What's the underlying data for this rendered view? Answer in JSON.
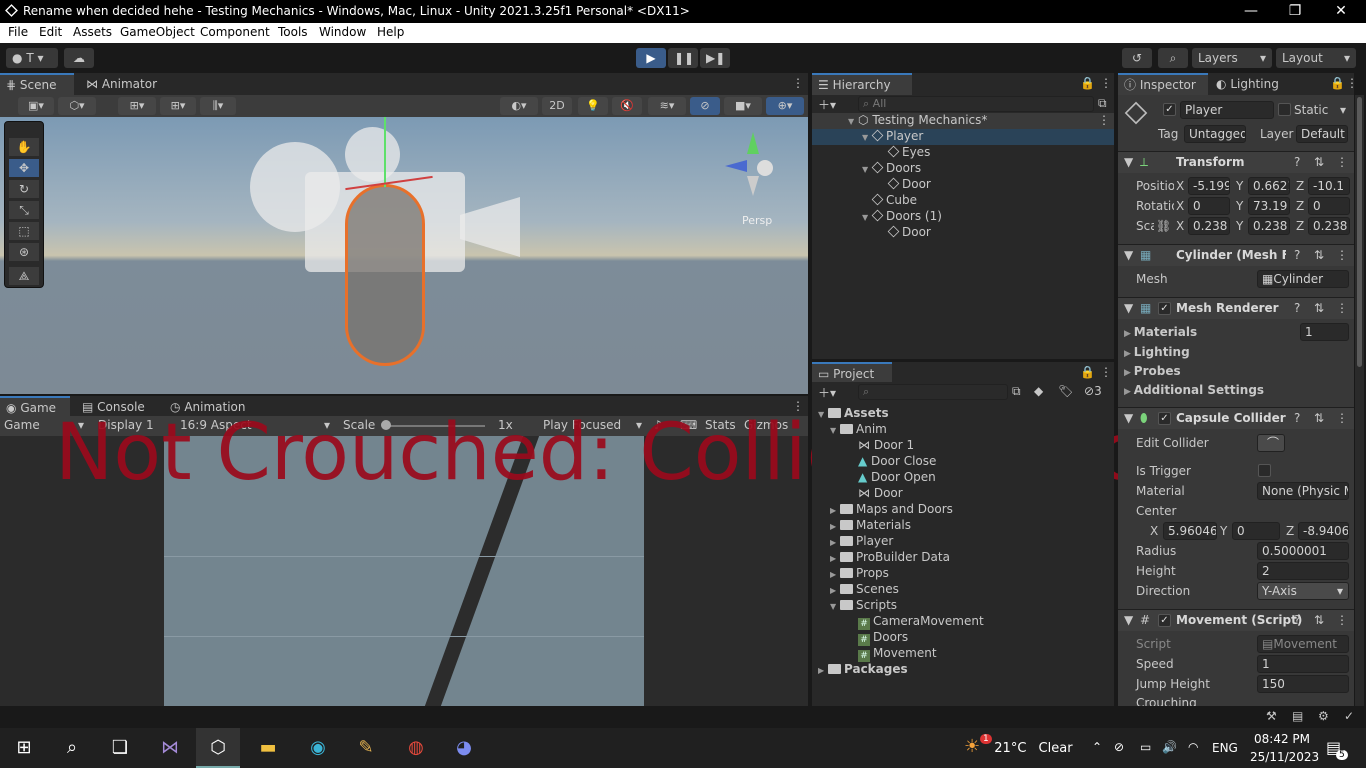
{
  "window": {
    "title": "Rename when decided hehe - Testing Mechanics - Windows, Mac, Linux - Unity 2021.3.25f1 Personal* <DX11>",
    "min": "—",
    "max": "❐",
    "close": "✕"
  },
  "menu": [
    "File",
    "Edit",
    "Assets",
    "GameObject",
    "Component",
    "Tools",
    "Window",
    "Help"
  ],
  "toolbar": {
    "account": "T",
    "layers": "Layers",
    "layout": "Layout"
  },
  "scene": {
    "tabs": [
      "Scene",
      "Animator"
    ],
    "btn2d": "2D",
    "persp": "Persp"
  },
  "game": {
    "tabs": [
      "Game",
      "Console",
      "Animation"
    ],
    "view": "Game",
    "display": "Display 1",
    "aspect": "16:9 Aspect",
    "scale_label": "Scale",
    "scale_value": "1x",
    "play_mode": "Play Focused",
    "stats": "Stats",
    "gizmos": "Gizmos",
    "overlay": "Not Crouched: Collider is normal"
  },
  "hierarchy": {
    "title": "Hierarchy",
    "search": "All",
    "root": "Testing Mechanics*",
    "items": [
      "Player",
      "Eyes",
      "Doors",
      "Door",
      "Cube",
      "Doors (1)",
      "Door"
    ]
  },
  "project": {
    "title": "Project",
    "hidden_count": "3",
    "root": "Assets",
    "anim": "Anim",
    "anim_items": [
      "Door 1",
      "Door Close",
      "Door Open",
      "Door"
    ],
    "folders": [
      "Maps and Doors",
      "Materials",
      "Player",
      "ProBuilder Data",
      "Props",
      "Scenes",
      "Scripts"
    ],
    "scripts": [
      "CameraMovement",
      "Doors",
      "Movement"
    ],
    "packages": "Packages"
  },
  "inspector": {
    "tabs": [
      "Inspector",
      "Lighting"
    ],
    "name": "Player",
    "static": "Static",
    "tag_label": "Tag",
    "tag": "Untagged",
    "layer_label": "Layer",
    "layer": "Default",
    "transform": {
      "title": "Transform",
      "pos_label": "Position",
      "rot_label": "Rotation",
      "scale_label": "Scale",
      "pos": [
        "-5.199",
        "0.6621",
        "-10.1"
      ],
      "rot": [
        "0",
        "73.19",
        "0"
      ],
      "scale": [
        "0.238",
        "0.238",
        "0.238"
      ]
    },
    "mesh_filter": {
      "title": "Cylinder (Mesh Filter)",
      "mesh_label": "Mesh",
      "mesh": "Cylinder"
    },
    "mesh_renderer": {
      "title": "Mesh Renderer",
      "materials": "Materials",
      "materials_count": "1",
      "lighting": "Lighting",
      "probes": "Probes",
      "additional": "Additional Settings"
    },
    "capsule": {
      "title": "Capsule Collider",
      "edit": "Edit Collider",
      "trigger": "Is Trigger",
      "material_label": "Material",
      "material": "None (Physic Material)",
      "center": "Center",
      "cx": "5.960468",
      "cy": "0",
      "cz": "-8.940697",
      "radius_label": "Radius",
      "radius": "0.5000001",
      "height_label": "Height",
      "height": "2",
      "dir_label": "Direction",
      "dir": "Y-Axis"
    },
    "movement": {
      "title": "Movement (Script)",
      "script_label": "Script",
      "script": "Movement",
      "speed_label": "Speed",
      "speed": "1",
      "jump_label": "Jump Height",
      "jump": "150",
      "crouch_label": "Crouching"
    }
  },
  "axes": [
    "X",
    "Y",
    "Z"
  ],
  "taskbar": {
    "temp": "21°C",
    "weather": "Clear",
    "lang": "ENG",
    "time": "08:42 PM",
    "date": "25/11/2023",
    "notif": "5",
    "weather_badge": "1"
  }
}
